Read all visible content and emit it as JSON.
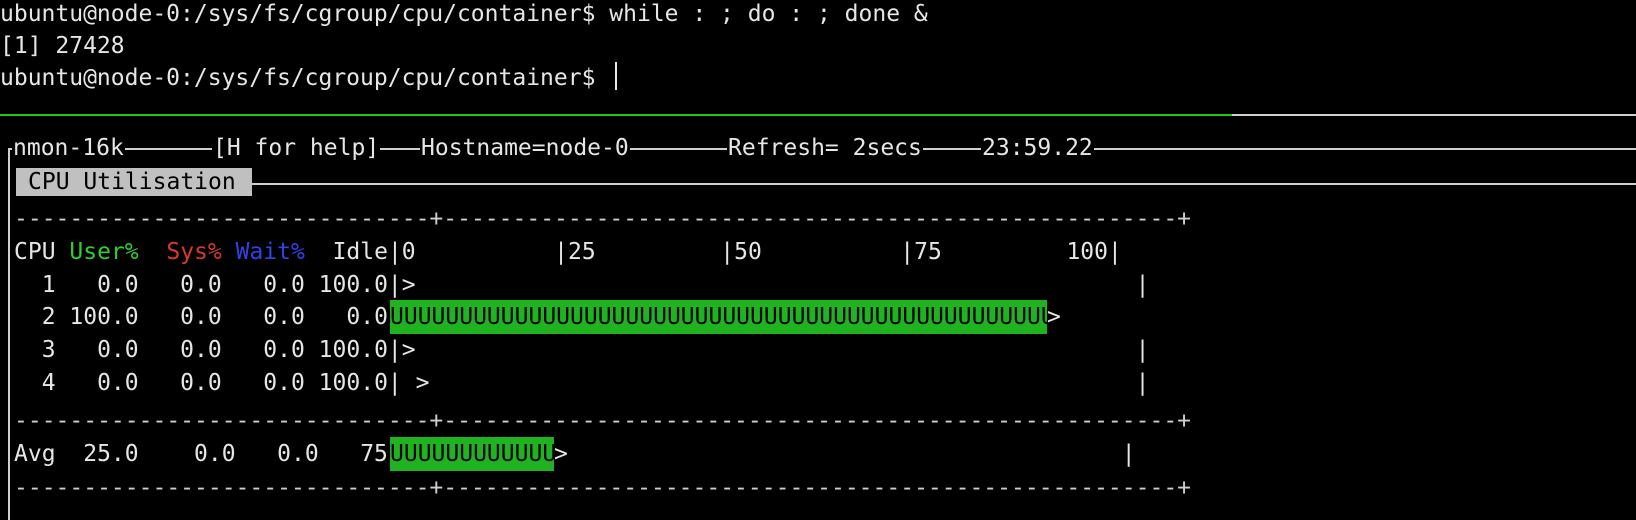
{
  "terminal": {
    "line1": "ubuntu@node-0:/sys/fs/cgroup/cpu/container$ while : ; do : ; done &",
    "line2": "[1] 27428",
    "line3": "ubuntu@node-0:/sys/fs/cgroup/cpu/container$ "
  },
  "nmon": {
    "name": "nmon",
    "version": "16k",
    "help": "[H for help]",
    "hostname": "Hostname=node-0",
    "refresh": "Refresh= 2secs",
    "time": "23:59.22",
    "panel_title": "CPU Utilisation",
    "dash_line": "------------------------------+-----------------------------------------------------+",
    "header": {
      "cpu": "CPU",
      "user": "User%",
      "sys": "Sys%",
      "wait": "Wait%",
      "idle": "Idle",
      "scale": "|0          |25         |50          |75         100|"
    },
    "rows": [
      {
        "cpu": "1",
        "user": "0.0",
        "sys": "0.0",
        "wait": "0.0",
        "idle": "100.0",
        "graph": "|>                                                    |",
        "bar": ""
      },
      {
        "cpu": "2",
        "user": "100.0",
        "sys": "0.0",
        "wait": "0.0",
        "idle": "0.0",
        "graph": "|",
        "bar": "UUUUUUUUUUUUUUUUUUUUUUUUUUUUUUUUUUUUUUUUUUUUUUUUUUUU>",
        "usage_fraction": 1.0
      },
      {
        "cpu": "3",
        "user": "0.0",
        "sys": "0.0",
        "wait": "0.0",
        "idle": "100.0",
        "graph": "|>                                                    |",
        "bar": ""
      },
      {
        "cpu": "4",
        "user": "0.0",
        "sys": "0.0",
        "wait": "0.0",
        "idle": "100.0",
        "graph": "| >                                                   |",
        "bar": ""
      }
    ],
    "avg": {
      "label": "Avg",
      "user": "25.0",
      "sys": "0.0",
      "wait": "0.0",
      "idle": "75.0",
      "graph": "|",
      "bar": "UUUUUUUUUUUUU",
      "tail": ">                                        |",
      "usage_fraction": 0.25
    },
    "colors": {
      "user": "#2fcf2f",
      "sys": "#d63a2f",
      "wait": "#2f44e6",
      "bar": "#1fb31f"
    }
  }
}
